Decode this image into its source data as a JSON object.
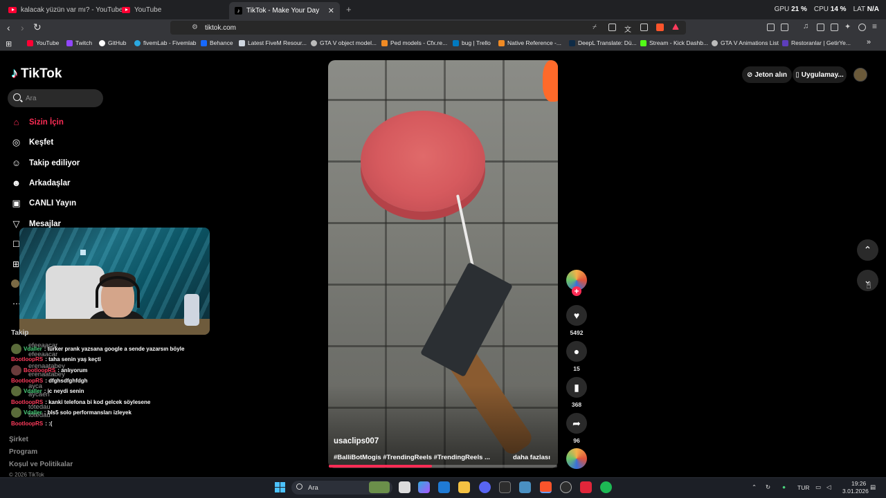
{
  "browser": {
    "tabs": [
      {
        "label": "kalacak yüzün var mı? - YouTube"
      },
      {
        "label": "YouTube"
      },
      {
        "label": "TikTok - Make Your Day"
      }
    ],
    "new_tab": "+",
    "url": "tiktok.com",
    "stats": {
      "gpu_label": "GPU",
      "gpu_value": "21 %",
      "cpu_label": "CPU",
      "cpu_value": "14 %",
      "extra_label": "LAT",
      "extra_value": "N/A"
    },
    "bookmarks": [
      {
        "label": "YouTube",
        "color": "#ff0033"
      },
      {
        "label": "Twitch",
        "color": "#9146ff"
      },
      {
        "label": "GitHub",
        "color": "#ffffff"
      },
      {
        "label": "fivemLab - Fivemlab",
        "color": "#2aa8e0"
      },
      {
        "label": "Behance",
        "color": "#1769ff"
      },
      {
        "label": "Latest FiveM Resour...",
        "color": "#cfd6e0"
      },
      {
        "label": "GTA V object model...",
        "color": "#bbbbbb"
      },
      {
        "label": "Ped models - Cfx.re...",
        "color": "#f08a24"
      },
      {
        "label": "bug | Trello",
        "color": "#0079bf"
      },
      {
        "label": "Native Reference -...",
        "color": "#f08a24"
      },
      {
        "label": "DeepL Translate: Dü...",
        "color": "#0f2b46"
      },
      {
        "label": "Stream - Kick Dashb...",
        "color": "#53fc18"
      },
      {
        "label": "GTA V Animations List",
        "color": "#bbbbbb"
      },
      {
        "label": "Restoranlar | GetirYe...",
        "color": "#5d3ebc"
      }
    ]
  },
  "tiktok": {
    "logo": "TikTok",
    "search_placeholder": "Ara",
    "nav": [
      {
        "label": "Sizin İçin",
        "icon": "home-icon",
        "active": true
      },
      {
        "label": "Keşfet",
        "icon": "compass-icon"
      },
      {
        "label": "Takip ediliyor",
        "icon": "following-icon"
      },
      {
        "label": "Arkadaşlar",
        "icon": "friends-icon"
      },
      {
        "label": "CANLI Yayın",
        "icon": "live-icon"
      },
      {
        "label": "Mesajlar",
        "icon": "messages-icon"
      }
    ],
    "following_header": "Takip",
    "following_ghost": [
      "efeeaacar",
      "efeeaacar",
      "erenaatabey",
      "erenaatabey",
      "ayca",
      "aycaen",
      "totedau",
      "totedau"
    ],
    "footer": [
      "Şirket",
      "Program",
      "Koşul ve Politikalar",
      "© 2026 TikTok"
    ],
    "video": {
      "username": "usaclips007",
      "hashtags": "#BalliBotMogis #TrendingReels #TrendingReels ...",
      "more": "daha fazlası",
      "progress": 0.45
    },
    "actions": {
      "likes": "5492",
      "comments": "15",
      "saves": "368",
      "shares": "96"
    },
    "top_right": {
      "coins": "Jeton alın",
      "app": "Uygulamay..."
    }
  },
  "chat": [
    {
      "user": "Vdaller",
      "msg": ": türker prank yazsana google a sende yazarsın böyle",
      "user_color": "green",
      "avatar": true
    },
    {
      "user": "BootloopRS",
      "msg": ": taha senin yaş keçti",
      "user_color": "red",
      "avatar": false
    },
    {
      "user": "BootloopRS",
      "msg": ": anlıyorum",
      "user_color": "red",
      "avatar": true
    },
    {
      "user": "BootloopRS",
      "msg": ": dfghsdfghfdgh",
      "user_color": "red",
      "avatar": false
    },
    {
      "user": "Vdaller",
      "msg": ": ic neydi senin",
      "user_color": "green",
      "avatar": true
    },
    {
      "user": "BootloopRS",
      "msg": ": kanki telefona bi kod gelcek söylesene",
      "user_color": "red",
      "avatar": false
    },
    {
      "user": "Vdaller",
      "msg": ": bls5 solo performansları izleyek",
      "user_color": "green",
      "avatar": true
    },
    {
      "user": "BootloopRS",
      "msg": ": :(",
      "user_color": "red",
      "avatar": false
    }
  ],
  "taskbar": {
    "search_placeholder": "Ara",
    "lang": "TUR",
    "time": "19:26",
    "date": "3.01.2026"
  }
}
